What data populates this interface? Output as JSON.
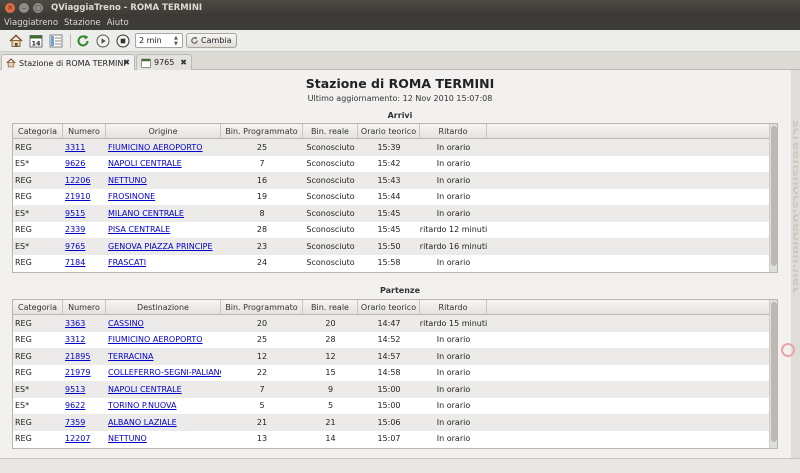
{
  "window": {
    "title": "QViaggiaTreno - ROMA TERMINI"
  },
  "menu": [
    "Viaggiatreno",
    "Stazione",
    "Aiuto"
  ],
  "toolbar": {
    "interval_value": "2 min",
    "change_label": "Cambia",
    "calendar_day": "14"
  },
  "tabs": [
    {
      "label": "Stazione di ROMA TERMINI",
      "active": true
    },
    {
      "label": "9765",
      "active": false
    }
  ],
  "station": {
    "title": "Stazione di ROMA TERMINI",
    "last_update": "Ultimo aggiornamento: 12 Nov 2010 15:07:08"
  },
  "arrivals": {
    "title": "Arrivi",
    "columns": [
      "Categoria",
      "Numero",
      "Origine",
      "Bin. Programmato",
      "Bin. reale",
      "Orario teorico",
      "Ritardo"
    ],
    "rows": [
      [
        "REG",
        "3311",
        "FIUMICINO AEROPORTO",
        "25",
        "Sconosciuto",
        "15:39",
        "In orario"
      ],
      [
        "ES*",
        "9626",
        "NAPOLI CENTRALE",
        "7",
        "Sconosciuto",
        "15:42",
        "In orario"
      ],
      [
        "REG",
        "12206",
        "NETTUNO",
        "16",
        "Sconosciuto",
        "15:43",
        "In orario"
      ],
      [
        "REG",
        "21910",
        "FROSINONE",
        "19",
        "Sconosciuto",
        "15:44",
        "In orario"
      ],
      [
        "ES*",
        "9515",
        "MILANO CENTRALE",
        "8",
        "Sconosciuto",
        "15:45",
        "In orario"
      ],
      [
        "REG",
        "2339",
        "PISA CENTRALE",
        "28",
        "Sconosciuto",
        "15:45",
        "ritardo 12 minuti"
      ],
      [
        "ES*",
        "9765",
        "GENOVA PIAZZA PRINCIPE",
        "23",
        "Sconosciuto",
        "15:50",
        "ritardo 16 minuti"
      ],
      [
        "REG",
        "7184",
        "FRASCATI",
        "24",
        "Sconosciuto",
        "15:58",
        "In orario"
      ]
    ]
  },
  "departures": {
    "title": "Partenze",
    "columns": [
      "Categoria",
      "Numero",
      "Destinazione",
      "Bin. Programmato",
      "Bin. reale",
      "Orario teorico",
      "Ritardo"
    ],
    "rows": [
      [
        "REG",
        "3363",
        "CASSINO",
        "20",
        "20",
        "14:47",
        "ritardo 15 minuti"
      ],
      [
        "REG",
        "3312",
        "FIUMICINO AEROPORTO",
        "25",
        "28",
        "14:52",
        "In orario"
      ],
      [
        "REG",
        "21895",
        "TERRACINA",
        "12",
        "12",
        "14:57",
        "In orario"
      ],
      [
        "REG",
        "21979",
        "COLLEFERRO-SEGNI-PALIANO",
        "22",
        "15",
        "14:58",
        "In orario"
      ],
      [
        "ES*",
        "9513",
        "NAPOLI CENTRALE",
        "7",
        "9",
        "15:00",
        "In orario"
      ],
      [
        "ES*",
        "9622",
        "TORINO P.NUOVA",
        "5",
        "5",
        "15:00",
        "In orario"
      ],
      [
        "REG",
        "7359",
        "ALBANO LAZIALE",
        "21",
        "21",
        "15:06",
        "In orario"
      ],
      [
        "REG",
        "12207",
        "NETTUNO",
        "13",
        "14",
        "15:07",
        "In orario"
      ]
    ]
  },
  "watermark": "screenshots.debian.net"
}
